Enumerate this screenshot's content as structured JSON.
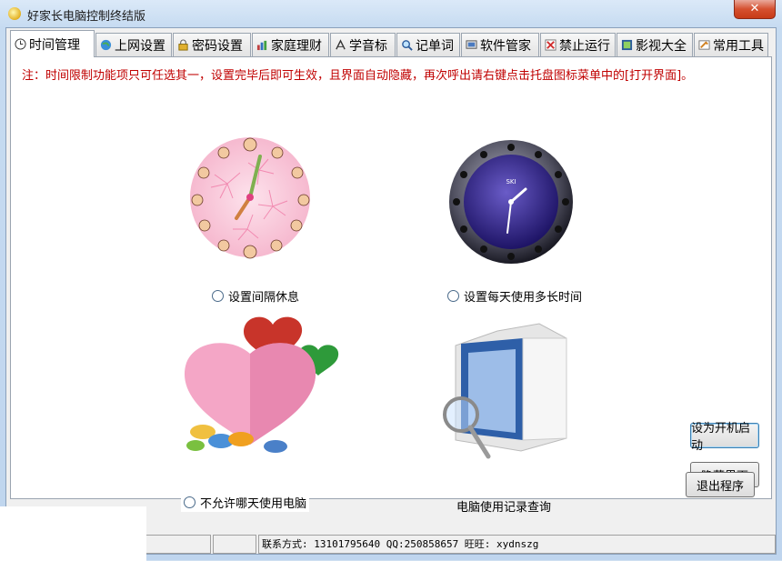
{
  "window": {
    "title": "好家长电脑控制终结版",
    "close_glyph": "✕"
  },
  "tabs": [
    {
      "label": "时间管理",
      "icon": "clock-icon",
      "active": true
    },
    {
      "label": "上网设置",
      "icon": "globe-icon"
    },
    {
      "label": "密码设置",
      "icon": "lock-icon"
    },
    {
      "label": "家庭理财",
      "icon": "finance-icon"
    },
    {
      "label": "学音标",
      "icon": "phonetic-icon"
    },
    {
      "label": "记单词",
      "icon": "magnifier-icon"
    },
    {
      "label": "软件管家",
      "icon": "software-icon"
    },
    {
      "label": "禁止运行",
      "icon": "block-icon"
    },
    {
      "label": "影视大全",
      "icon": "video-icon"
    },
    {
      "label": "常用工具",
      "icon": "tools-icon"
    }
  ],
  "notice": "注：时间限制功能项只可任选其一，设置完毕后即可生效，且界面自动隐藏，再次呼出请右键点击托盘图标菜单中的[打开界面]。",
  "options": {
    "interval_rest": "设置间隔休息",
    "daily_limit": "设置每天使用多长时间",
    "block_days": "不允许哪天使用电脑",
    "usage_log": "电脑使用记录查询"
  },
  "clock_face_text": "SKI",
  "buttons": {
    "autostart": "设为开机启动",
    "hide": "隐藏界面",
    "exit": "退出程序"
  },
  "status": {
    "contact": "联系方式: 13101795640   QQ:250858657   旺旺: xydnszg"
  }
}
